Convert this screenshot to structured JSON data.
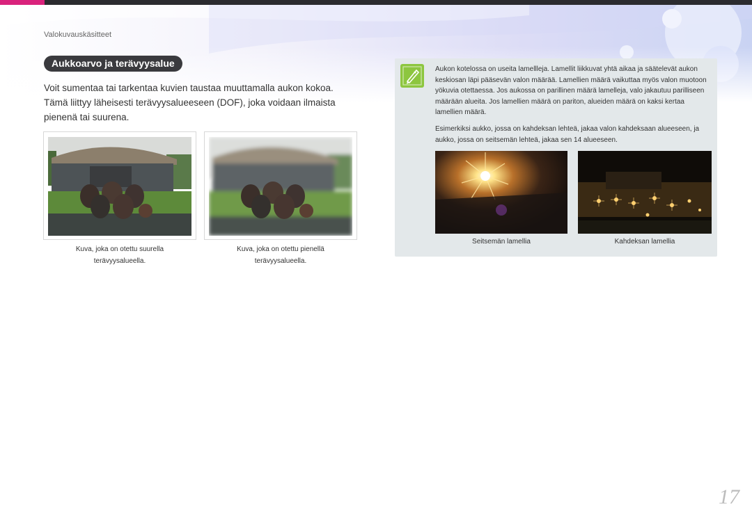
{
  "header": {
    "breadcrumb": "Valokuvauskäsitteet",
    "accent_color": "#d9227c",
    "bar_color": "#2b2b2f"
  },
  "section": {
    "title": "Aukkoarvo ja terävyysalue",
    "intro": "Voit sumentaa tai tarkentaa kuvien taustaa muuttamalla aukon kokoa. Tämä liittyy läheisesti terävyysalueeseen (DOF), joka voidaan ilmaista pienenä tai suurena."
  },
  "photos": [
    {
      "caption_line1": "Kuva, joka on otettu suurella",
      "caption_line2": "terävyysalueella."
    },
    {
      "caption_line1": "Kuva, joka on otettu pienellä",
      "caption_line2": "terävyysalueella."
    }
  ],
  "note": {
    "icon": "pen-note-icon",
    "icon_color": "#8dc63f",
    "background": "#e3e8ea",
    "paragraph1": "Aukon kotelossa on useita lamellleja. Lamellit liikkuvat yhtä aikaa ja säätelevät aukon keskiosan läpi pääsevän valon määrää. Lamellien määrä vaikuttaa myös valon muotoon yökuvia otettaessa. Jos aukossa on parillinen määrä lamelleja, valo jakautuu parilliseen määrään alueita. Jos lamellien määrä on pariton, alueiden määrä on kaksi kertaa lamellien määrä.",
    "paragraph2": "Esimerkiksi aukko, jossa on kahdeksan lehteä, jakaa valon kahdeksaan alueeseen, ja aukko, jossa on seitsemän lehteä, jakaa sen 14 alueeseen.",
    "examples": [
      {
        "caption": "Seitsemän lamellia"
      },
      {
        "caption": "Kahdeksan lamellia"
      }
    ]
  },
  "page": {
    "number": "17"
  }
}
